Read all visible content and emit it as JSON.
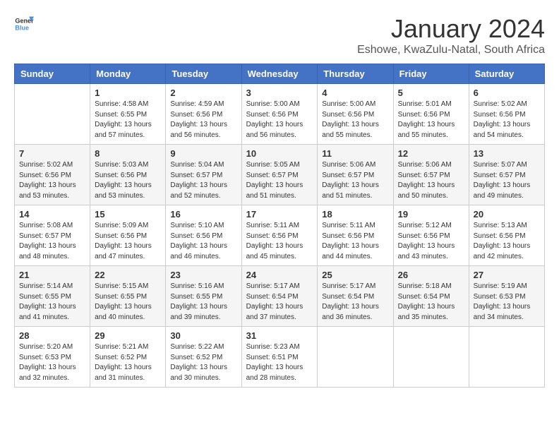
{
  "header": {
    "logo_general": "General",
    "logo_blue": "Blue",
    "month_title": "January 2024",
    "subtitle": "Eshowe, KwaZulu-Natal, South Africa"
  },
  "days_of_week": [
    "Sunday",
    "Monday",
    "Tuesday",
    "Wednesday",
    "Thursday",
    "Friday",
    "Saturday"
  ],
  "weeks": [
    [
      {
        "day": "",
        "info": ""
      },
      {
        "day": "1",
        "info": "Sunrise: 4:58 AM\nSunset: 6:55 PM\nDaylight: 13 hours\nand 57 minutes."
      },
      {
        "day": "2",
        "info": "Sunrise: 4:59 AM\nSunset: 6:56 PM\nDaylight: 13 hours\nand 56 minutes."
      },
      {
        "day": "3",
        "info": "Sunrise: 5:00 AM\nSunset: 6:56 PM\nDaylight: 13 hours\nand 56 minutes."
      },
      {
        "day": "4",
        "info": "Sunrise: 5:00 AM\nSunset: 6:56 PM\nDaylight: 13 hours\nand 55 minutes."
      },
      {
        "day": "5",
        "info": "Sunrise: 5:01 AM\nSunset: 6:56 PM\nDaylight: 13 hours\nand 55 minutes."
      },
      {
        "day": "6",
        "info": "Sunrise: 5:02 AM\nSunset: 6:56 PM\nDaylight: 13 hours\nand 54 minutes."
      }
    ],
    [
      {
        "day": "7",
        "info": "Sunrise: 5:02 AM\nSunset: 6:56 PM\nDaylight: 13 hours\nand 53 minutes."
      },
      {
        "day": "8",
        "info": "Sunrise: 5:03 AM\nSunset: 6:56 PM\nDaylight: 13 hours\nand 53 minutes."
      },
      {
        "day": "9",
        "info": "Sunrise: 5:04 AM\nSunset: 6:57 PM\nDaylight: 13 hours\nand 52 minutes."
      },
      {
        "day": "10",
        "info": "Sunrise: 5:05 AM\nSunset: 6:57 PM\nDaylight: 13 hours\nand 51 minutes."
      },
      {
        "day": "11",
        "info": "Sunrise: 5:06 AM\nSunset: 6:57 PM\nDaylight: 13 hours\nand 51 minutes."
      },
      {
        "day": "12",
        "info": "Sunrise: 5:06 AM\nSunset: 6:57 PM\nDaylight: 13 hours\nand 50 minutes."
      },
      {
        "day": "13",
        "info": "Sunrise: 5:07 AM\nSunset: 6:57 PM\nDaylight: 13 hours\nand 49 minutes."
      }
    ],
    [
      {
        "day": "14",
        "info": "Sunrise: 5:08 AM\nSunset: 6:57 PM\nDaylight: 13 hours\nand 48 minutes."
      },
      {
        "day": "15",
        "info": "Sunrise: 5:09 AM\nSunset: 6:56 PM\nDaylight: 13 hours\nand 47 minutes."
      },
      {
        "day": "16",
        "info": "Sunrise: 5:10 AM\nSunset: 6:56 PM\nDaylight: 13 hours\nand 46 minutes."
      },
      {
        "day": "17",
        "info": "Sunrise: 5:11 AM\nSunset: 6:56 PM\nDaylight: 13 hours\nand 45 minutes."
      },
      {
        "day": "18",
        "info": "Sunrise: 5:11 AM\nSunset: 6:56 PM\nDaylight: 13 hours\nand 44 minutes."
      },
      {
        "day": "19",
        "info": "Sunrise: 5:12 AM\nSunset: 6:56 PM\nDaylight: 13 hours\nand 43 minutes."
      },
      {
        "day": "20",
        "info": "Sunrise: 5:13 AM\nSunset: 6:56 PM\nDaylight: 13 hours\nand 42 minutes."
      }
    ],
    [
      {
        "day": "21",
        "info": "Sunrise: 5:14 AM\nSunset: 6:55 PM\nDaylight: 13 hours\nand 41 minutes."
      },
      {
        "day": "22",
        "info": "Sunrise: 5:15 AM\nSunset: 6:55 PM\nDaylight: 13 hours\nand 40 minutes."
      },
      {
        "day": "23",
        "info": "Sunrise: 5:16 AM\nSunset: 6:55 PM\nDaylight: 13 hours\nand 39 minutes."
      },
      {
        "day": "24",
        "info": "Sunrise: 5:17 AM\nSunset: 6:54 PM\nDaylight: 13 hours\nand 37 minutes."
      },
      {
        "day": "25",
        "info": "Sunrise: 5:17 AM\nSunset: 6:54 PM\nDaylight: 13 hours\nand 36 minutes."
      },
      {
        "day": "26",
        "info": "Sunrise: 5:18 AM\nSunset: 6:54 PM\nDaylight: 13 hours\nand 35 minutes."
      },
      {
        "day": "27",
        "info": "Sunrise: 5:19 AM\nSunset: 6:53 PM\nDaylight: 13 hours\nand 34 minutes."
      }
    ],
    [
      {
        "day": "28",
        "info": "Sunrise: 5:20 AM\nSunset: 6:53 PM\nDaylight: 13 hours\nand 32 minutes."
      },
      {
        "day": "29",
        "info": "Sunrise: 5:21 AM\nSunset: 6:52 PM\nDaylight: 13 hours\nand 31 minutes."
      },
      {
        "day": "30",
        "info": "Sunrise: 5:22 AM\nSunset: 6:52 PM\nDaylight: 13 hours\nand 30 minutes."
      },
      {
        "day": "31",
        "info": "Sunrise: 5:23 AM\nSunset: 6:51 PM\nDaylight: 13 hours\nand 28 minutes."
      },
      {
        "day": "",
        "info": ""
      },
      {
        "day": "",
        "info": ""
      },
      {
        "day": "",
        "info": ""
      }
    ]
  ]
}
